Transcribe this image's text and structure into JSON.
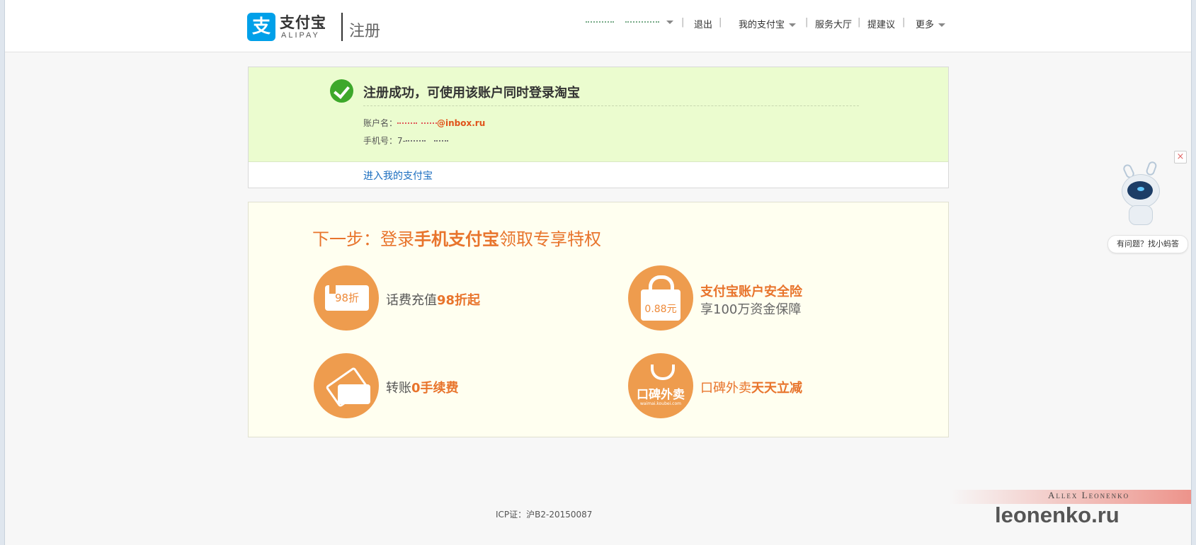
{
  "header": {
    "logo_cn": "支付宝",
    "logo_en": "ALIPAY",
    "page_label": "注册",
    "nav": {
      "logout": "退出",
      "my_alipay": "我的支付宝",
      "service_hall": "服务大厅",
      "suggest": "提建议",
      "more": "更多"
    }
  },
  "success": {
    "title": "注册成功，可使用该账户同时登录淘宝",
    "account_label": "账户名：",
    "account_value": "@inbox.ru",
    "phone_label": "手机号：",
    "phone_value": "7-",
    "enter_link": "进入我的支付宝"
  },
  "next_step": {
    "title_prefix": "下一步：登录",
    "title_highlight": "手机支付宝",
    "title_suffix": "领取专享特权",
    "features": [
      {
        "icon_text": "98折",
        "text": "话费充值",
        "highlight": "98折起"
      },
      {
        "icon_text": "0.88元",
        "title": "支付宝账户安全险",
        "sub": "享100万资金保障"
      },
      {
        "text": "转账",
        "highlight": "0手续费"
      },
      {
        "icon_text": "口碑外卖",
        "icon_sub": "waimai.koubei.com",
        "text": "口碑外卖",
        "highlight": "天天立减"
      }
    ]
  },
  "footer": {
    "icp": "ICP证：沪B2-20150087"
  },
  "assistant": {
    "bubble": "有问题？找小蚂答",
    "close": "×"
  },
  "watermark": {
    "name": "Allex Leonenko",
    "site": "leonenko.ru"
  },
  "colors": {
    "accent_orange": "#e8742c",
    "icon_orange": "#ee9c4e",
    "success_green": "#3da82b",
    "link_blue": "#1a6dbf"
  }
}
